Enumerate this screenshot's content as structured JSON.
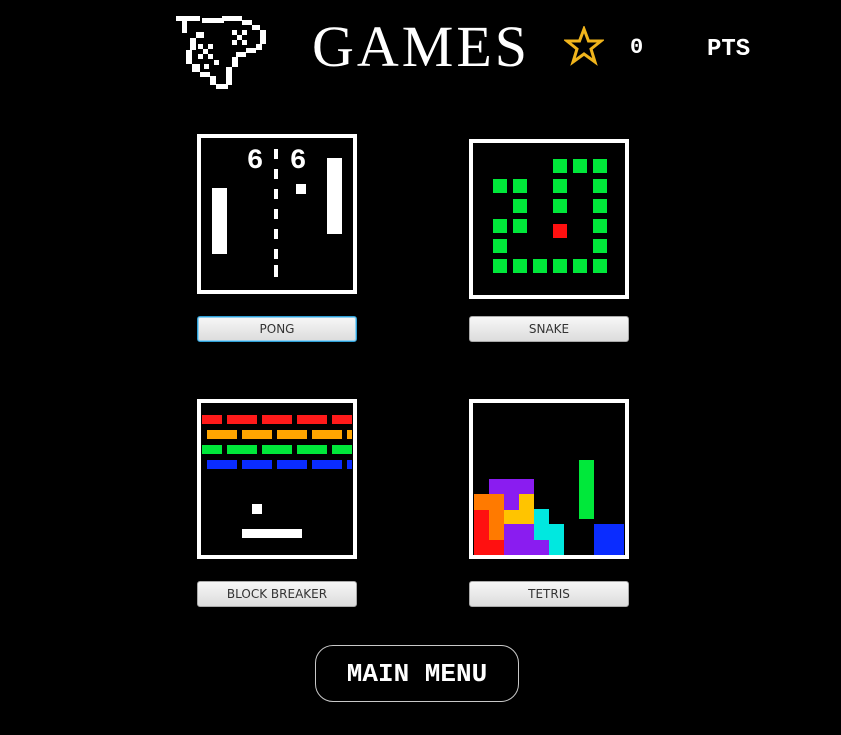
{
  "header": {
    "logo_icon": "gamepad-icon",
    "title": "GAMES",
    "star_icon": "star-icon",
    "star_color": "#f1b51c",
    "score": "0",
    "score_unit": "PTS"
  },
  "games": [
    {
      "label": "PONG",
      "icon": "pong-thumbnail",
      "focused": true,
      "score_left": "6",
      "score_right": "6"
    },
    {
      "label": "SNAKE",
      "icon": "snake-thumbnail"
    },
    {
      "label": "BLOCK BREAKER",
      "icon": "block-breaker-thumbnail"
    },
    {
      "label": "TETRIS",
      "icon": "tetris-thumbnail"
    }
  ],
  "footer": {
    "main_menu_label": "MAIN MENU"
  },
  "colors": {
    "background": "#000000",
    "snake_green": "#00e83a",
    "snake_food": "#ff1010",
    "brick_red": "#ff1a1a",
    "brick_orange": "#ffa500",
    "brick_green": "#00e83a",
    "brick_blue": "#0a2cff"
  }
}
